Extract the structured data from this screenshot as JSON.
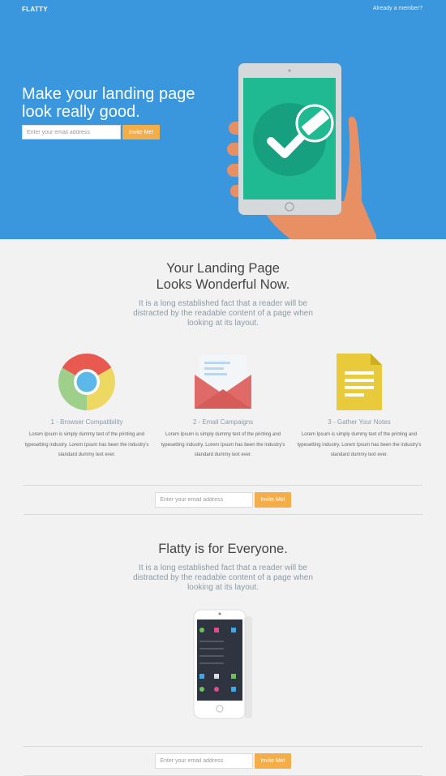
{
  "header": {
    "brand": "FLATTY",
    "member_link": "Already a member?"
  },
  "hero": {
    "title_line1": "Make your landing page",
    "title_line2": "look really good.",
    "email_placeholder": "Enter your email address",
    "invite_label": "Invite Me!"
  },
  "features_section": {
    "title_line1": "Your Landing Page",
    "title_line2": "Looks Wonderful Now.",
    "subtitle": "It is a long established fact that a reader will be distracted by the readable content of a page when looking at its layout.",
    "items": [
      {
        "icon": "chrome-icon",
        "title": "1 - Browser Compatibility",
        "text": "Lorem Ipsum is simply dummy text of the printing and typesetting industry. Lorem Ipsum has been the industry's standard dummy text ever."
      },
      {
        "icon": "envelope-icon",
        "title": "2 - Email Campaigns",
        "text": "Lorem Ipsum is simply dummy text of the printing and typesetting industry. Lorem Ipsum has been the industry's standard dummy text ever."
      },
      {
        "icon": "notes-icon",
        "title": "3 - Gather Your Notes",
        "text": "Lorem Ipsum is simply dummy text of the printing and typesetting industry. Lorem Ipsum has been the industry's standard dummy text ever."
      }
    ]
  },
  "signup": {
    "email_placeholder": "Enter your email address",
    "invite_label": "Invite Me!"
  },
  "everyone_section": {
    "title": "Flatty is for Everyone.",
    "subtitle": "It is a long established fact that a reader will be distracted by the readable content of a page when looking at its layout."
  },
  "signup2": {
    "email_placeholder": "Enter your email address",
    "invite_label": "Invite Me!"
  },
  "colors": {
    "hero_bg": "#3a97dd",
    "accent": "#f5ad47",
    "page_bg": "#f2f2f2",
    "tablet_screen": "#1fb992"
  }
}
